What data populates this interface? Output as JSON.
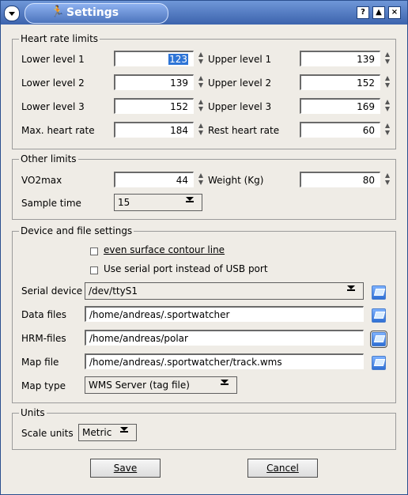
{
  "window": {
    "title": "Settings"
  },
  "heart_rate_limits": {
    "title": "Heart rate limits",
    "lower1_label": "Lower level 1",
    "lower1_value": "123",
    "upper1_label": "Upper level 1",
    "upper1_value": "139",
    "lower2_label": "Lower level 2",
    "lower2_value": "139",
    "upper2_label": "Upper level 2",
    "upper2_value": "152",
    "lower3_label": "Lower level 3",
    "lower3_value": "152",
    "upper3_label": "Upper level 3",
    "upper3_value": "169",
    "max_label": "Max. heart rate",
    "max_value": "184",
    "rest_label": "Rest heart rate",
    "rest_value": "60"
  },
  "other_limits": {
    "title": "Other limits",
    "vo2_label": "VO2max",
    "vo2_value": "44",
    "weight_label": "Weight (Kg)",
    "weight_value": "80",
    "sample_label": "Sample time",
    "sample_value": "15"
  },
  "device_settings": {
    "title": "Device and file settings",
    "contour_label": "even surface contour line",
    "serial_label": "Use serial port instead of USB port",
    "serial_device_label": "Serial device",
    "serial_device_value": "/dev/ttyS1",
    "data_files_label": "Data files",
    "data_files_value": "/home/andreas/.sportwatcher",
    "hrm_files_label": "HRM-files",
    "hrm_files_value": "/home/andreas/polar",
    "map_file_label": "Map file",
    "map_file_value": "/home/andreas/.sportwatcher/track.wms",
    "map_type_label": "Map type",
    "map_type_value": "WMS Server (tag file)"
  },
  "units": {
    "title": "Units",
    "scale_label": "Scale units",
    "scale_value": "Metric"
  },
  "buttons": {
    "save": "Save",
    "cancel": "Cancel"
  },
  "titlebar_buttons": {
    "help": "?",
    "shade": "▲",
    "close": "×"
  }
}
